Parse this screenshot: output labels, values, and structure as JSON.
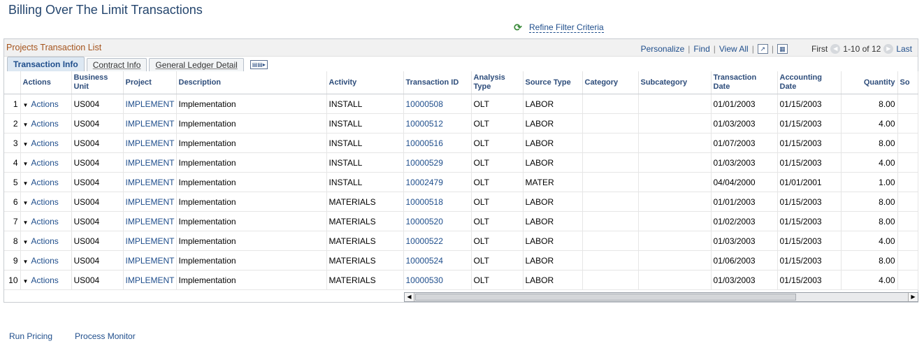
{
  "page": {
    "title": "Billing Over The Limit Transactions"
  },
  "refine": {
    "icon": "refresh-icon",
    "label": "Refine Filter Criteria"
  },
  "grid": {
    "title": "Projects Transaction List",
    "toolbar": {
      "personalize": "Personalize",
      "find": "Find",
      "view_all": "View All",
      "first": "First",
      "range": "1-10 of 12",
      "last": "Last"
    },
    "tabs": [
      {
        "label": "Transaction Info",
        "active": true
      },
      {
        "label": "Contract Info",
        "active": false
      },
      {
        "label": "General Ledger Detail",
        "active": false
      }
    ],
    "columns": [
      "",
      "Actions",
      "Business Unit",
      "Project",
      "Description",
      "Activity",
      "Transaction ID",
      "Analysis Type",
      "Source Type",
      "Category",
      "Subcategory",
      "Transaction Date",
      "Accounting Date",
      "Quantity",
      "So"
    ],
    "rows": [
      {
        "n": "1",
        "actions": "Actions",
        "bu": "US004",
        "project": "IMPLEMENT",
        "desc": "Implementation",
        "activity": "INSTALL",
        "txn": "10000508",
        "analysis": "OLT",
        "source": "LABOR",
        "category": "",
        "subcategory": "",
        "txn_date": "01/01/2003",
        "acct_date": "01/15/2003",
        "qty": "8.00"
      },
      {
        "n": "2",
        "actions": "Actions",
        "bu": "US004",
        "project": "IMPLEMENT",
        "desc": "Implementation",
        "activity": "INSTALL",
        "txn": "10000512",
        "analysis": "OLT",
        "source": "LABOR",
        "category": "",
        "subcategory": "",
        "txn_date": "01/03/2003",
        "acct_date": "01/15/2003",
        "qty": "4.00"
      },
      {
        "n": "3",
        "actions": "Actions",
        "bu": "US004",
        "project": "IMPLEMENT",
        "desc": "Implementation",
        "activity": "INSTALL",
        "txn": "10000516",
        "analysis": "OLT",
        "source": "LABOR",
        "category": "",
        "subcategory": "",
        "txn_date": "01/07/2003",
        "acct_date": "01/15/2003",
        "qty": "8.00"
      },
      {
        "n": "4",
        "actions": "Actions",
        "bu": "US004",
        "project": "IMPLEMENT",
        "desc": "Implementation",
        "activity": "INSTALL",
        "txn": "10000529",
        "analysis": "OLT",
        "source": "LABOR",
        "category": "",
        "subcategory": "",
        "txn_date": "01/03/2003",
        "acct_date": "01/15/2003",
        "qty": "4.00"
      },
      {
        "n": "5",
        "actions": "Actions",
        "bu": "US004",
        "project": "IMPLEMENT",
        "desc": "Implementation",
        "activity": "INSTALL",
        "txn": "10002479",
        "analysis": "OLT",
        "source": "MATER",
        "category": "",
        "subcategory": "",
        "txn_date": "04/04/2000",
        "acct_date": "01/01/2001",
        "qty": "1.00"
      },
      {
        "n": "6",
        "actions": "Actions",
        "bu": "US004",
        "project": "IMPLEMENT",
        "desc": "Implementation",
        "activity": "MATERIALS",
        "txn": "10000518",
        "analysis": "OLT",
        "source": "LABOR",
        "category": "",
        "subcategory": "",
        "txn_date": "01/01/2003",
        "acct_date": "01/15/2003",
        "qty": "8.00"
      },
      {
        "n": "7",
        "actions": "Actions",
        "bu": "US004",
        "project": "IMPLEMENT",
        "desc": "Implementation",
        "activity": "MATERIALS",
        "txn": "10000520",
        "analysis": "OLT",
        "source": "LABOR",
        "category": "",
        "subcategory": "",
        "txn_date": "01/02/2003",
        "acct_date": "01/15/2003",
        "qty": "8.00"
      },
      {
        "n": "8",
        "actions": "Actions",
        "bu": "US004",
        "project": "IMPLEMENT",
        "desc": "Implementation",
        "activity": "MATERIALS",
        "txn": "10000522",
        "analysis": "OLT",
        "source": "LABOR",
        "category": "",
        "subcategory": "",
        "txn_date": "01/03/2003",
        "acct_date": "01/15/2003",
        "qty": "4.00"
      },
      {
        "n": "9",
        "actions": "Actions",
        "bu": "US004",
        "project": "IMPLEMENT",
        "desc": "Implementation",
        "activity": "MATERIALS",
        "txn": "10000524",
        "analysis": "OLT",
        "source": "LABOR",
        "category": "",
        "subcategory": "",
        "txn_date": "01/06/2003",
        "acct_date": "01/15/2003",
        "qty": "8.00"
      },
      {
        "n": "10",
        "actions": "Actions",
        "bu": "US004",
        "project": "IMPLEMENT",
        "desc": "Implementation",
        "activity": "MATERIALS",
        "txn": "10000530",
        "analysis": "OLT",
        "source": "LABOR",
        "category": "",
        "subcategory": "",
        "txn_date": "01/03/2003",
        "acct_date": "01/15/2003",
        "qty": "4.00"
      }
    ]
  },
  "footer": {
    "run_pricing": "Run Pricing",
    "process_monitor": "Process Monitor"
  },
  "colors": {
    "link": "#1f4e8c",
    "grid_title": "#a4531c",
    "header_text": "#2e4d7b"
  }
}
